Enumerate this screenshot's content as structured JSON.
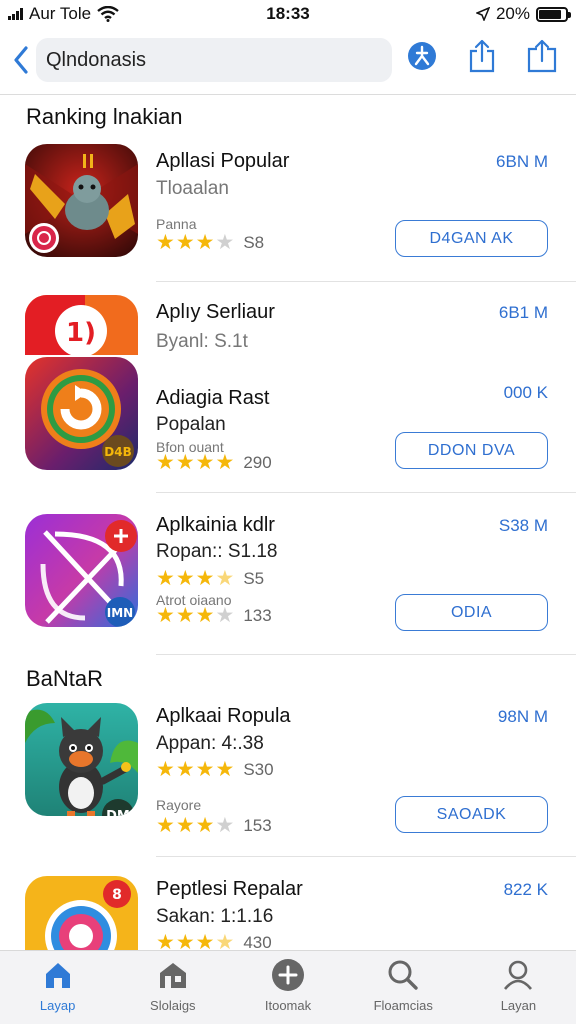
{
  "status_bar": {
    "carrier": "Aur Tole",
    "time": "18:33",
    "battery": "20%",
    "battery_level": 0.85
  },
  "nav": {
    "search_text": "Qlndonasis"
  },
  "sections": {
    "ranking_title": "Ranking lnakian",
    "banner_title": "BaNtaR"
  },
  "apps": [
    {
      "name": "Apllasi Popular",
      "sub": "Tloaalan",
      "small": "Panna",
      "stars": 3,
      "rating_count": "S8",
      "size": "6BN M",
      "button": "D4GAN AK"
    },
    {
      "name": "Aplıy Serliaur",
      "sub": "Byanl: S.1t",
      "size": "6B1 M"
    },
    {
      "name": "Adiagia Rast",
      "sub": "Popalan",
      "small": "Bfon ouant",
      "stars": 4,
      "rating_count": "290",
      "size": "000 K",
      "button": "DDON DVA",
      "badge": "D4B"
    },
    {
      "name": "Aplkainia kdlr",
      "sub": "Ropan:: S1.18",
      "stars": 3.5,
      "rating_count": "S5",
      "small": "Atrot oiaano",
      "stars2": 3,
      "rating_count2": "133",
      "size": "S38 M",
      "button": "ODIA",
      "badge": "IMN"
    },
    {
      "name": "Aplkaai Ropula",
      "sub": "Appan: 4:.38",
      "stars": 4.5,
      "rating_count": "S30",
      "small": "Rayore",
      "stars2": 3,
      "rating_count2": "153",
      "size": "98N M",
      "button": "SAOADK",
      "badge": "DM"
    },
    {
      "name": "Peptlesi Repalar",
      "sub": "Sakan: 1:1.16",
      "stars": 3.5,
      "rating_count": "430",
      "size": "822 K",
      "badge_top": "8"
    }
  ],
  "tabs": [
    {
      "label": "Layap",
      "icon": "house-icon",
      "active": true
    },
    {
      "label": "Slolaigs",
      "icon": "store-icon",
      "active": false
    },
    {
      "label": "Itoomak",
      "icon": "plus-icon",
      "active": false
    },
    {
      "label": "Floamcias",
      "icon": "search-icon",
      "active": false
    },
    {
      "label": "Layan",
      "icon": "person-icon",
      "active": false
    }
  ],
  "colors": {
    "accent": "#2f7ad6",
    "star": "#f5b70a",
    "button_border": "#3a7bd5"
  }
}
